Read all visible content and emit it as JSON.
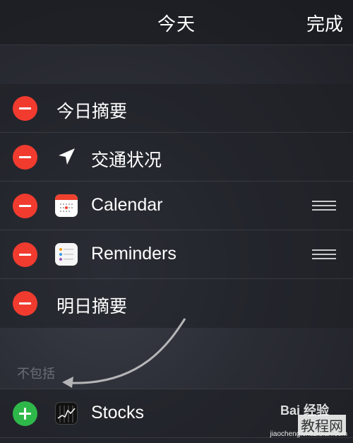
{
  "nav": {
    "title": "今天",
    "done_label": "完成"
  },
  "included": [
    {
      "label": "今日摘要",
      "icon": null,
      "handle": false
    },
    {
      "label": "交通状况",
      "icon": "location-arrow-icon",
      "handle": false
    },
    {
      "label": "Calendar",
      "icon": "calendar-app-icon",
      "handle": true
    },
    {
      "label": "Reminders",
      "icon": "reminders-app-icon",
      "handle": true
    },
    {
      "label": "明日摘要",
      "icon": null,
      "handle": false
    }
  ],
  "excluded_header": "不包括",
  "excluded": [
    {
      "label": "Stocks",
      "icon": "stocks-app-icon"
    }
  ],
  "watermark": {
    "brand": "Bai 经验",
    "site": "教程网",
    "url": "jiaocheng.chazidian.com"
  },
  "colors": {
    "delete": "#f23b2f",
    "add": "#2fb84a",
    "calendar_red": "#f0412f"
  }
}
